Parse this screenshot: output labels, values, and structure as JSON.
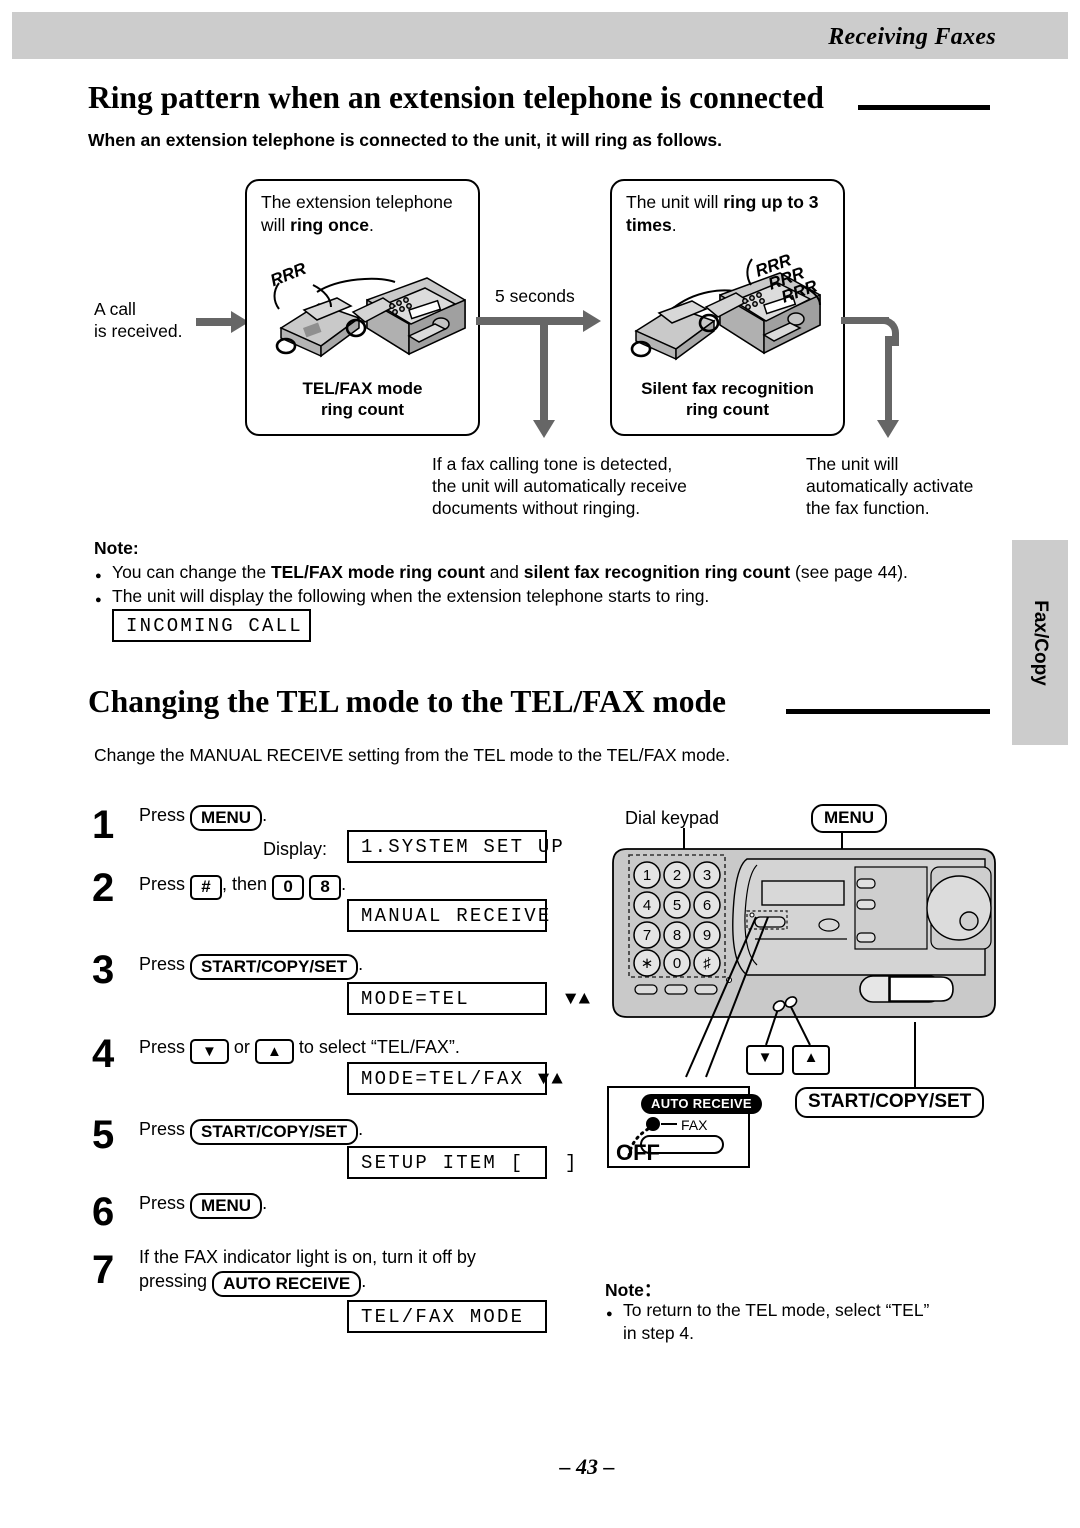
{
  "header": {
    "running_title": "Receiving Faxes"
  },
  "section1": {
    "heading": "Ring pattern when an extension telephone is connected",
    "lead": "When an extension telephone is connected to the unit, it will ring as follows.",
    "incoming_label_line1": "A call",
    "incoming_label_line2": "is received.",
    "box1": {
      "caption_plain_1": "The extension telephone",
      "caption_plain_2": "will ",
      "caption_bold": "ring once",
      "caption_tail": ".",
      "ring_sound": "RRR",
      "footer_line1": "TEL/FAX mode",
      "footer_line2": "ring count"
    },
    "timer_label": "5 seconds",
    "box2": {
      "caption_plain_1": "The unit will ",
      "caption_bold_1": "ring up to 3",
      "caption_bold_2": "times",
      "caption_tail": ".",
      "ring_sound_1": "RRR",
      "ring_sound_2": "RRR",
      "ring_sound_3": "RRR",
      "footer_line1": "Silent fax recognition",
      "footer_line2": "ring count"
    },
    "outcome_left": "If a fax calling tone is detected,\nthe unit will automatically receive\ndocuments without ringing.",
    "outcome_right": "The unit will\nautomatically activate\nthe fax function.",
    "note_heading": "Note:",
    "note_b1_pre": "You can change the ",
    "note_b1_bold1": "TEL/FAX mode ring count",
    "note_b1_mid": " and ",
    "note_b1_bold2": "silent fax recognition ring count",
    "note_b1_post": " (see page 44).",
    "note_b2": "The unit will display the following when the extension telephone starts to ring.",
    "lcd_incoming": "INCOMING CALL"
  },
  "section2": {
    "heading": "Changing the TEL mode to the TEL/FAX mode",
    "intro": "Change the MANUAL RECEIVE setting from the TEL mode to the TEL/FAX mode.",
    "display_label": "Display:",
    "steps": [
      {
        "n": "1",
        "press": "Press",
        "key": "MENU",
        "tail": ".",
        "lcd": "1.SYSTEM SET UP"
      },
      {
        "n": "2",
        "press": "Press",
        "key1": "#",
        "mid": ", then",
        "key2": "0",
        "key3": "8",
        "tail": ".",
        "lcd": "MANUAL RECEIVE"
      },
      {
        "n": "3",
        "press": "Press",
        "key": "START/COPY/SET",
        "tail": ".",
        "lcd": "MODE=TEL       ▼▲"
      },
      {
        "n": "4",
        "press": "Press",
        "key1": "▼",
        "mid": "or",
        "key2": "▲",
        "tail": "to select “TEL/FAX”.",
        "lcd": "MODE=TEL/FAX ▼▲"
      },
      {
        "n": "5",
        "press": "Press",
        "key": "START/COPY/SET",
        "tail": ".",
        "lcd": "SETUP ITEM [   ]"
      },
      {
        "n": "6",
        "press": "Press",
        "key": "MENU",
        "tail": ".",
        "lcd": ""
      },
      {
        "n": "7",
        "line1": "If the FAX indicator light is on, turn it off by",
        "line2_pre": "pressing",
        "key": "AUTO RECEIVE",
        "tail": ".",
        "lcd": "TEL/FAX MODE"
      }
    ],
    "machine": {
      "dial_keypad_label": "Dial keypad",
      "menu_callout": "MENU",
      "start_callout": "START/COPY/SET",
      "keys": [
        "1",
        "2",
        "3",
        "4",
        "5",
        "6",
        "7",
        "8",
        "9",
        "∗",
        "0",
        "♯"
      ],
      "down_key": "▼",
      "up_key": "▲",
      "auto_receive_label": "AUTO RECEIVE",
      "fax_label": "FAX",
      "off_label": "OFF"
    },
    "note_heading": "Note：",
    "note_line1": "To return to the TEL mode, select “TEL”",
    "note_line2": "in step 4."
  },
  "sidebar": {
    "tab_label": "Fax/Copy"
  },
  "footer": {
    "page_number": "– 43 –"
  }
}
